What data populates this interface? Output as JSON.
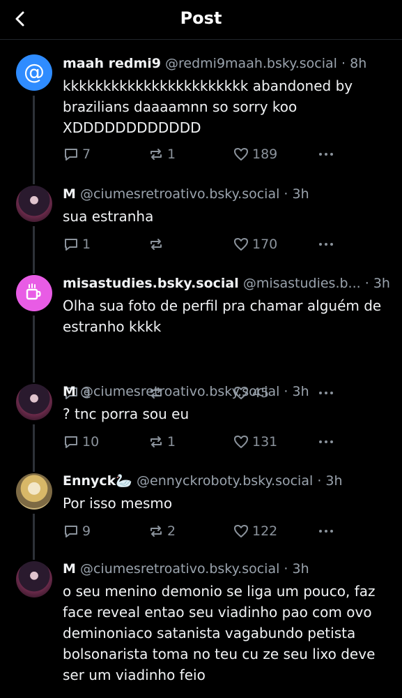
{
  "header": {
    "title": "Post"
  },
  "posts": [
    {
      "name": "maah redmi9",
      "handle": "@redmi9maah.bsky.social",
      "time": "8h",
      "text": "kkkkkkkkkkkkkkkkkkkkkkk abandoned by brazilians daaaamnn so sorry koo XDDDDDDDDDDDD",
      "replies": "7",
      "reposts": "1",
      "likes": "189",
      "avatar": "at-icon"
    },
    {
      "name": "M",
      "handle": "@ciumesretroativo.bsky.social",
      "time": "3h",
      "text": "sua estranha",
      "replies": "1",
      "reposts": "",
      "likes": "170",
      "avatar": "photo"
    },
    {
      "name": "misastudies.bsky.social",
      "handle": "@misastudies.b...",
      "time": "3h",
      "text": "Olha sua foto de perfil pra chamar alguém de estranho kkkk",
      "replies": "3",
      "reposts": "",
      "likes": "45",
      "avatar": "mug-icon"
    },
    {
      "name": "M",
      "handle": "@ciumesretroativo.bsky.social",
      "time": "3h",
      "text": "? tnc porra sou eu",
      "replies": "10",
      "reposts": "1",
      "likes": "131",
      "avatar": "photo"
    },
    {
      "name": "Ennyck🦢",
      "handle": "@ennyckroboty.bsky.social",
      "time": "3h",
      "text": "Por isso mesmo",
      "replies": "9",
      "reposts": "2",
      "likes": "122",
      "avatar": "photo"
    },
    {
      "name": "M",
      "handle": "@ciumesretroativo.bsky.social",
      "time": "3h",
      "text": "o seu menino demonio se liga um pouco, faz face reveal entao seu viadinho pao com ovo deminoniaco satanista vagabundo petista bolsonarista toma no teu cu ze seu lixo deve ser um viadinho feio",
      "replies": "",
      "reposts": "",
      "likes": "",
      "avatar": "photo"
    }
  ],
  "meta_separator": "·",
  "colors": {
    "background": "#000000",
    "text": "#f1f3f5",
    "muted": "#9aa3ad",
    "thread_line": "#2e3238",
    "at_avatar": "#2f8cff",
    "mug_avatar": "#e85ce5"
  }
}
